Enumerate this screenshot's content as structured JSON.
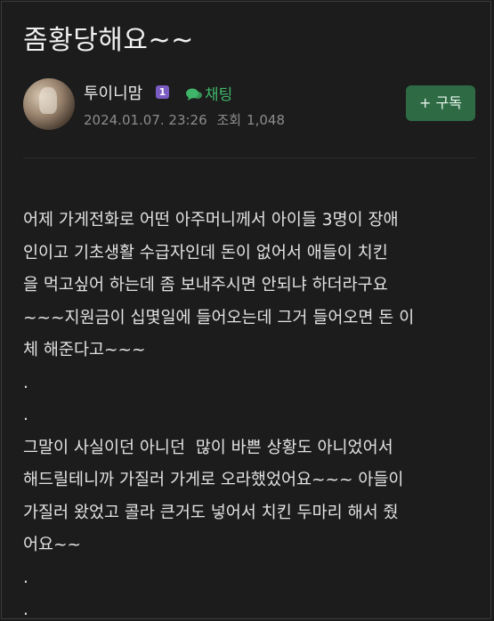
{
  "post": {
    "title": "좀황당해요~~",
    "author": {
      "name": "투이니맘",
      "level_badge": "1"
    },
    "chat_label": "채팅",
    "date": "2024.01.07. 23:26",
    "views_label": "조회",
    "views": "1,048",
    "subscribe_label": "+ 구독",
    "lines": [
      "어제 가게전화로 어떤 아주머니께서 아이들 3명이 장애",
      "인이고 기초생활 수급자인데 돈이 없어서 애들이 치킨",
      "을 먹고싶어 하는데 좀 보내주시면 안되냐 하더라구요",
      "~~~지원금이 십몇일에 들어오는데 그거 들어오면 돈 이",
      "체 해준다고~~~",
      ".",
      ".",
      "그말이 사실이던 아니던  많이 바쁜 상황도 아니었어서",
      "해드릴테니까 가질러 가게로 오라했었어요~~~ 아들이",
      "가질러 왔었고 콜라 큰거도 넣어서 치킨 두마리 해서 줬",
      "어요~~",
      ".",
      "."
    ]
  },
  "colors": {
    "background": "#1c1c1c",
    "accent_green": "#3fb56a",
    "subscribe_bg": "#2e6b45",
    "level_badge": "#7a5cc2"
  },
  "icons": {
    "chat": "chat-bubble-icon"
  }
}
